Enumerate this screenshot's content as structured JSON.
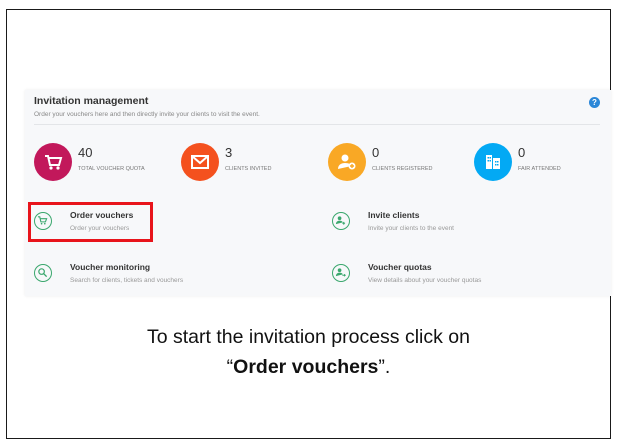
{
  "panel": {
    "title": "Invitation management",
    "subtitle": "Order your vouchers here and then directly invite your clients to visit the event.",
    "help_glyph": "?"
  },
  "stats": [
    {
      "value": "40",
      "label": "TOTAL VOUCHER QUOTA",
      "color": "#c2185b",
      "icon": "cart-icon"
    },
    {
      "value": "3",
      "label": "CLIENTS INVITED",
      "color": "#f4511e",
      "icon": "envelope-icon"
    },
    {
      "value": "0",
      "label": "CLIENTS REGISTERED",
      "color": "#f9a825",
      "icon": "user-add-icon"
    },
    {
      "value": "0",
      "label": "FAIR ATTENDED",
      "color": "#03a9f4",
      "icon": "building-icon"
    }
  ],
  "actions": [
    {
      "name": "Order vouchers",
      "desc": "Order your vouchers",
      "icon": "cart-icon"
    },
    {
      "name": "Invite clients",
      "desc": "Invite your clients to the event",
      "icon": "user-add-icon"
    },
    {
      "name": "Voucher monitoring",
      "desc": "Search for clients, tickets and vouchers",
      "icon": "search-icon"
    },
    {
      "name": "Voucher quotas",
      "desc": "View details about your voucher quotas",
      "icon": "user-share-icon"
    }
  ],
  "colors": {
    "accent_green": "#3aa76d",
    "highlight_red": "#e8141b",
    "help_blue": "#2b87d8"
  },
  "caption": {
    "line1": "To start the invitation process click on",
    "open_quote": "“",
    "bold": "Order vouchers",
    "close_quote": "”."
  }
}
